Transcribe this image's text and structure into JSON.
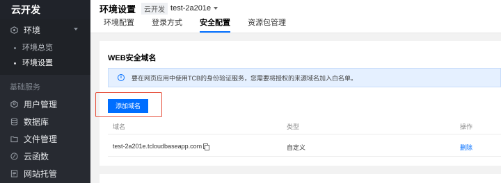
{
  "sidebar": {
    "brand": "云开发",
    "env_group": {
      "label": "环境",
      "icon": "hexagon-icon",
      "items": [
        {
          "label": "环境总览"
        },
        {
          "label": "环境设置"
        }
      ]
    },
    "section_label": "基础服务",
    "services": [
      {
        "label": "用户管理",
        "icon": "user-icon"
      },
      {
        "label": "数据库",
        "icon": "database-icon"
      },
      {
        "label": "文件管理",
        "icon": "folder-icon"
      },
      {
        "label": "云函数",
        "icon": "function-icon"
      },
      {
        "label": "网站托管",
        "icon": "website-icon"
      }
    ]
  },
  "header": {
    "title": "环境设置",
    "env_badge": "云开发",
    "env_name": "test-2a201e",
    "tabs": [
      {
        "label": "环境配置"
      },
      {
        "label": "登录方式"
      },
      {
        "label": "安全配置"
      },
      {
        "label": "资源包管理"
      }
    ]
  },
  "card": {
    "title": "WEB安全域名",
    "info": "要在网页应用中使用TCB的身份验证服务，您需要将授权的来源域名加入白名单。",
    "add_button": "添加域名",
    "columns": {
      "domain": "域名",
      "type": "类型",
      "action": "操作"
    },
    "rows": [
      {
        "domain": "test-2a201e.tcloudbaseapp.com",
        "type": "自定义",
        "action": "删除"
      }
    ]
  },
  "colors": {
    "accent": "#006eff",
    "sidebar": "#272a31",
    "highlight": "#e6503c"
  }
}
